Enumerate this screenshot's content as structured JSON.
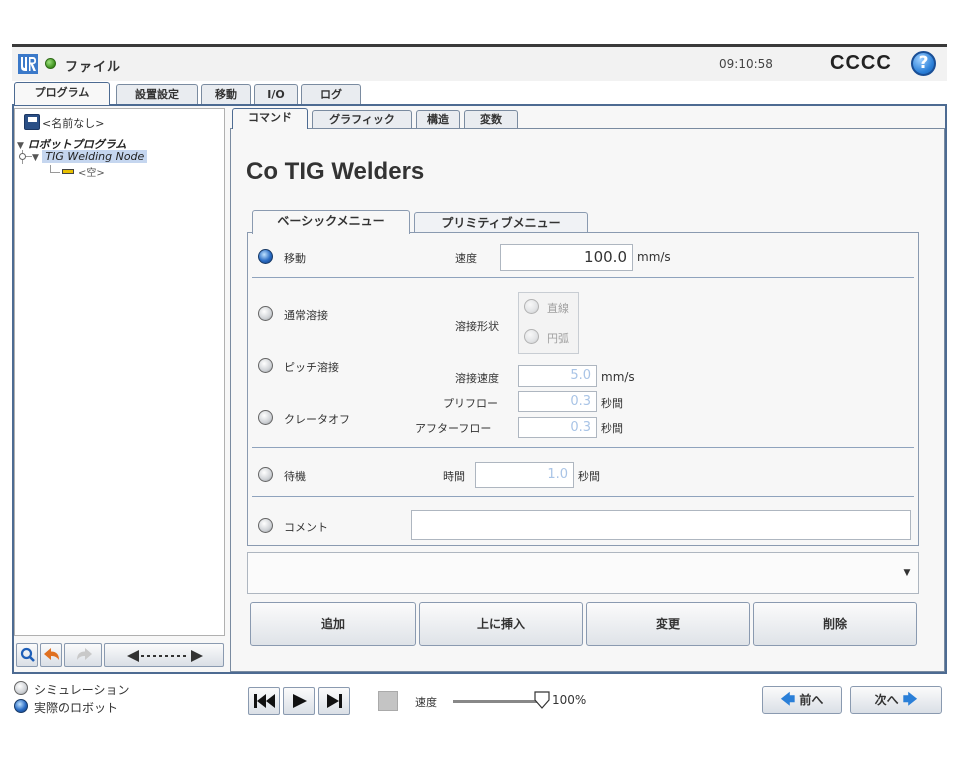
{
  "header": {
    "file_title": "ファイル",
    "clock": "09:10:58",
    "robot_name": "CCCC",
    "help_label": "?"
  },
  "top_tabs": [
    "プログラム",
    "設置設定",
    "移動",
    "I/O",
    "ログ"
  ],
  "program_tree": {
    "program_name": "<名前なし>",
    "root": "ロボットプログラム",
    "node": "TIG Welding Node",
    "child": "<空>"
  },
  "sub_tabs": [
    "コマンド",
    "グラフィック",
    "構造",
    "変数"
  ],
  "page_title": "Co TIG Welders",
  "menu_tabs": [
    "ベーシックメニュー",
    "プリミティブメニュー"
  ],
  "basic_menu": {
    "move_label": "移動",
    "speed_label": "速度",
    "speed_value": "100.0",
    "speed_unit": "mm/s",
    "normal_weld": "通常溶接",
    "pitch_weld": "ピッチ溶接",
    "crater_off": "クレータオフ",
    "weld_shape_label": "溶接形状",
    "shape_linear": "直線",
    "shape_arc": "円弧",
    "weld_speed_label": "溶接速度",
    "weld_speed_value": "5.0",
    "weld_speed_unit": "mm/s",
    "preflow_label": "プリフロー",
    "preflow_value": "0.3",
    "preflow_unit": "秒間",
    "afterflow_label": "アフターフロー",
    "afterflow_value": "0.3",
    "afterflow_unit": "秒間",
    "wait_label": "待機",
    "time_label": "時間",
    "time_value": "1.0",
    "time_unit": "秒間",
    "comment_label": "コメント",
    "comment_value": ""
  },
  "actions": [
    "追加",
    "上に挿入",
    "変更",
    "削除"
  ],
  "footer": {
    "simulation": "シミュレーション",
    "real_robot": "実際のロボット",
    "speed_label": "速度",
    "speed_percent": "100%",
    "speed_fraction": 1.0,
    "prev": "前へ",
    "next": "次へ"
  },
  "colors": {
    "accent_blue": "#2a6cc4",
    "frame_border": "#4d6b92",
    "nav_arrow": "#2a7fd8",
    "undo_arrow": "#e07020"
  }
}
